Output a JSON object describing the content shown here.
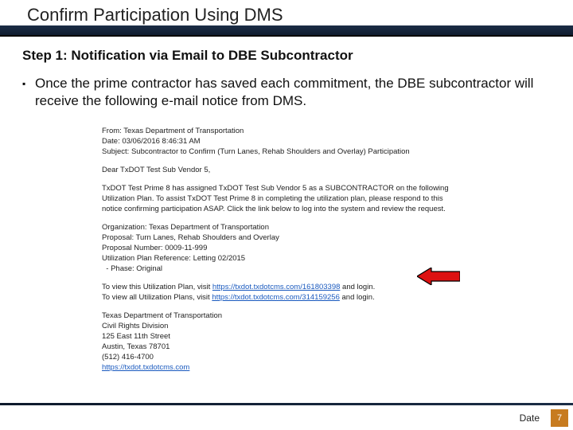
{
  "title": "Confirm Participation Using DMS",
  "step_heading": "Step 1: Notification via Email to DBE Subcontractor",
  "bullet_text": "Once the prime contractor has saved each commitment, the DBE subcontractor will receive the following e-mail notice from DMS.",
  "email": {
    "from": "From: Texas Department of Transportation",
    "date": "Date: 03/06/2016 8:46:31 AM",
    "subject": "Subject: Subcontractor to Confirm (Turn Lanes, Rehab Shoulders and Overlay) Participation",
    "greeting": "Dear TxDOT Test Sub Vendor 5,",
    "body1": "TxDOT Test Prime 8 has assigned TxDOT Test Sub Vendor 5 as a SUBCONTRACTOR on the following",
    "body2": "Utilization Plan. To assist TxDOT Test Prime 8 in completing the utilization plan, please respond to this",
    "body3": "notice confirming participation ASAP. Click the link below to log into the system and review the request.",
    "org": "Organization: Texas Department of Transportation",
    "proposal": "Proposal: Turn Lanes, Rehab Shoulders and Overlay",
    "proposal_num": "Proposal Number: 0009-11-999",
    "plan_ref": "Utilization Plan Reference: Letting 02/2015",
    "phase": "  - Phase: Original",
    "view_this_pre": "To view this Utilization Plan, visit ",
    "view_this_link": "https://txdot.txdotcms.com/161803398",
    "view_all_pre": "To view all Utilization Plans, visit ",
    "view_all_link": "https://txdot.txdotcms.com/314159256",
    "and_login": " and login.",
    "sig1": "Texas Department of Transportation",
    "sig2": "Civil Rights Division",
    "sig3": "125 East 11th Street",
    "sig4": "Austin, Texas 78701",
    "sig5": "(512) 416-4700",
    "sig6": "https://txdot.txdotcms.com"
  },
  "footer": {
    "date_label": "Date",
    "page_number": "7"
  },
  "icons": {
    "red_arrow": "red-arrow-left-icon"
  }
}
